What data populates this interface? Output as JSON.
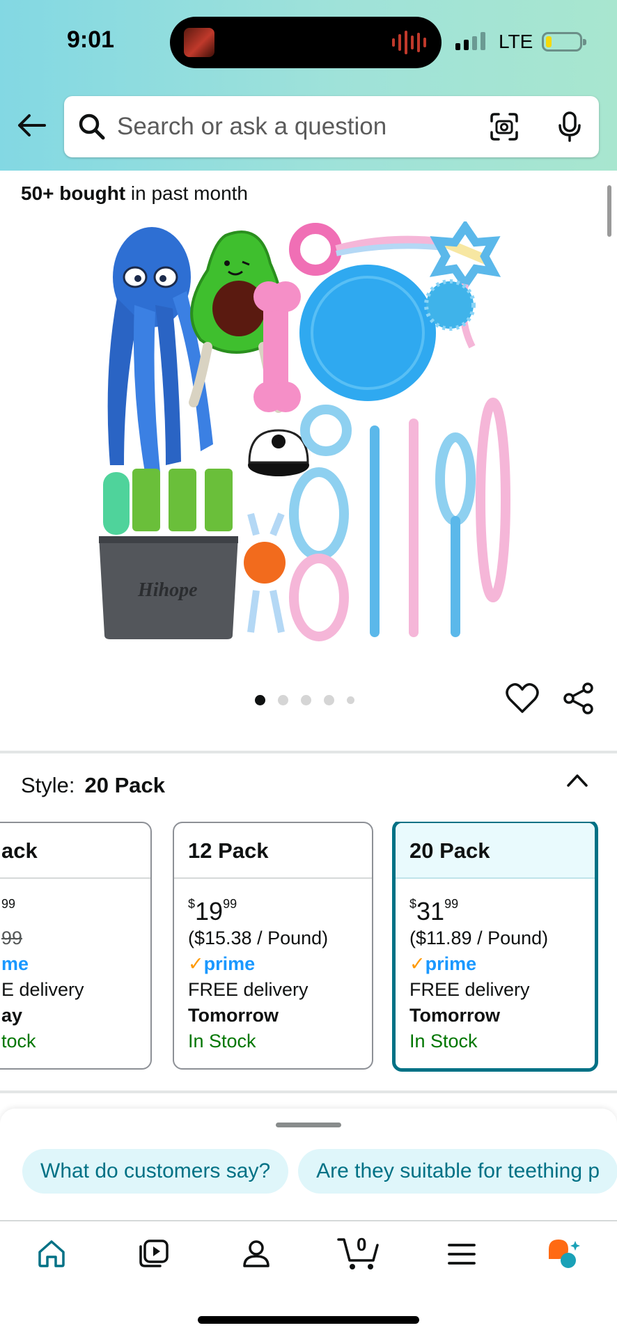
{
  "status_bar": {
    "time": "9:01",
    "network": "LTE"
  },
  "search": {
    "placeholder": "Search or ask a question"
  },
  "product": {
    "bought_bold": "50+ bought",
    "bought_rest": " in past month",
    "image_brand_text": "Hihope",
    "image_count": 5,
    "image_index": 1
  },
  "style": {
    "label": "Style:",
    "value": "20 Pack"
  },
  "options": [
    {
      "title": "ack",
      "price_dollar": "",
      "price_cents": "99",
      "unit_price": "99",
      "prime": "me",
      "delivery": "E delivery",
      "delivery_day": "ay",
      "stock": "tock"
    },
    {
      "title": "12 Pack",
      "price_dollar": "$",
      "price_whole": "19",
      "price_cents": "99",
      "unit_price": "($15.38 / Pound)",
      "prime": "prime",
      "delivery": "FREE delivery",
      "delivery_day": "Tomorrow",
      "stock": "In Stock"
    },
    {
      "title": "20 Pack",
      "price_dollar": "$",
      "price_whole": "31",
      "price_cents": "99",
      "unit_price": "($11.89 / Pound)",
      "prime": "prime",
      "delivery": "FREE delivery",
      "delivery_day": "Tomorrow",
      "stock": "In Stock",
      "selected": true
    }
  ],
  "assistant_chips": [
    "What do customers say?",
    "Are they suitable for teething p"
  ],
  "tab_bar": {
    "items": [
      "home-icon",
      "video-icon",
      "account-icon",
      "cart-icon",
      "menu-icon",
      "rufus-icon"
    ],
    "cart_count": "0"
  },
  "colors": {
    "accent": "#007185",
    "prime": "#1a98ff",
    "in_stock": "#007600",
    "header_start": "#83d8e3",
    "header_end": "#a8e6cf"
  }
}
